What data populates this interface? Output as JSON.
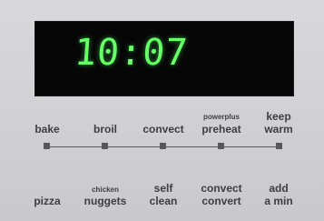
{
  "display": {
    "time": "10:07"
  },
  "top_row": [
    {
      "small": "",
      "line1": "bake",
      "line2": ""
    },
    {
      "small": "",
      "line1": "broil",
      "line2": ""
    },
    {
      "small": "",
      "line1": "convect",
      "line2": ""
    },
    {
      "small": "powerplus",
      "line1": "preheat",
      "line2": ""
    },
    {
      "small": "",
      "line1": "keep",
      "line2": "warm"
    }
  ],
  "bottom_row": [
    {
      "small": "",
      "line1": "pizza",
      "line2": ""
    },
    {
      "small": "chicken",
      "line1": "nuggets",
      "line2": ""
    },
    {
      "small": "",
      "line1": "self",
      "line2": "clean"
    },
    {
      "small": "",
      "line1": "convect",
      "line2": "convert"
    },
    {
      "small": "",
      "line1": "add",
      "line2": "a min"
    }
  ]
}
